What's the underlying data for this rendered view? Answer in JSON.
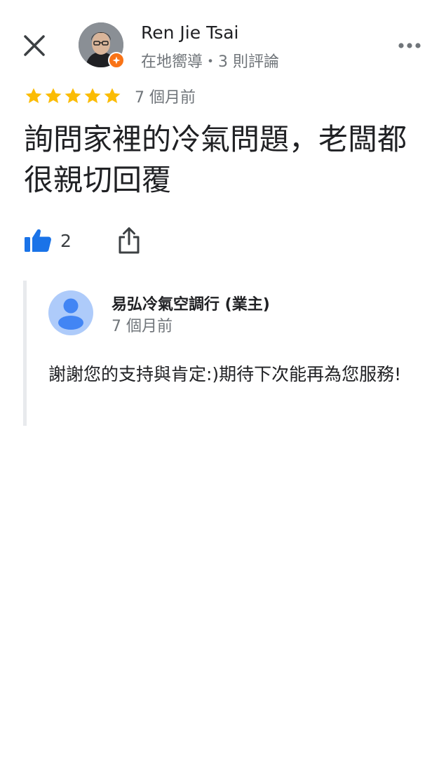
{
  "header": {
    "reviewer_name": "Ren Jie Tsai",
    "reviewer_meta": "在地嚮導・3 則評論",
    "close_icon": "close-icon",
    "more_icon": "more-horizontal-icon"
  },
  "review": {
    "rating": 5,
    "rating_max": 5,
    "time": "7 個月前",
    "text": "詢問家裡的冷氣問題，老闆都很親切回覆",
    "like_count": "2"
  },
  "owner_reply": {
    "name": "易弘冷氣空調行 (業主)",
    "time": "7 個月前",
    "text": "謝謝您的支持與肯定:)期待下次能再為您服務!"
  },
  "colors": {
    "star": "#fbbc04",
    "like": "#1a73e8",
    "guide_badge": "#f97316",
    "owner_avatar_bg": "#aecbfa",
    "owner_avatar_fg": "#4285f4"
  }
}
